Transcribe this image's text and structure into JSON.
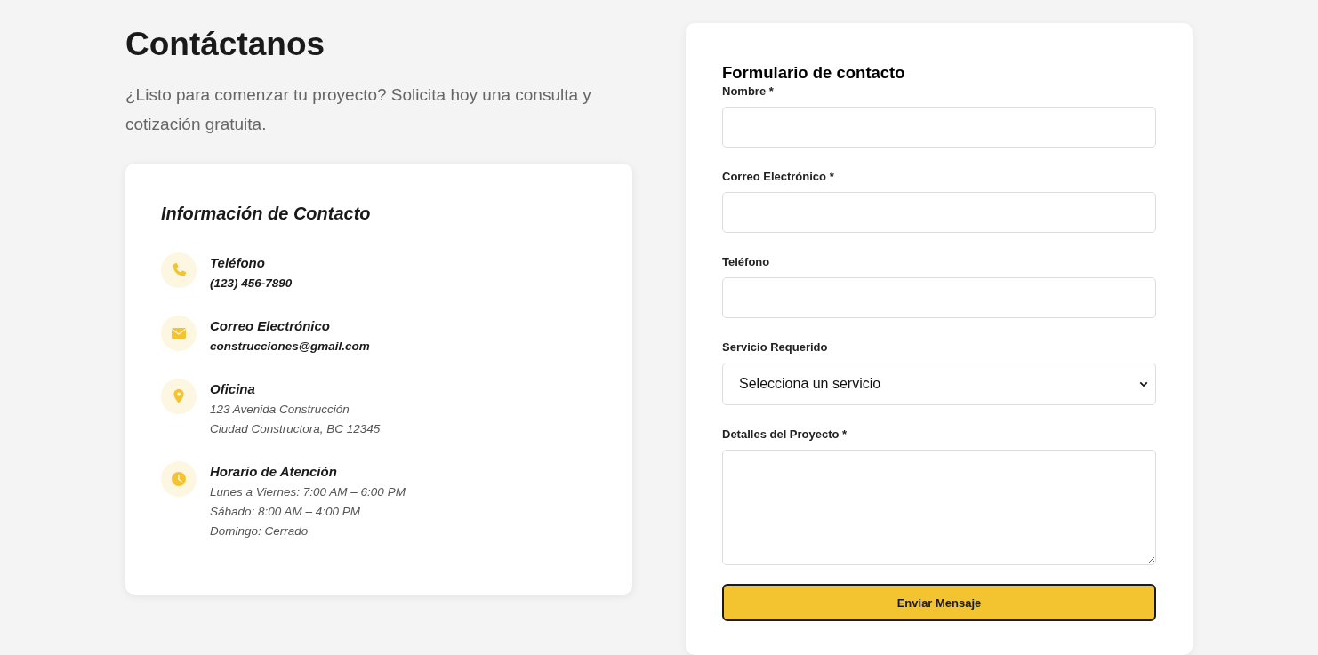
{
  "header": {
    "title": "Contáctanos",
    "subtitle": "¿Listo para comenzar tu proyecto? Solicita hoy una consulta y cotización gratuita."
  },
  "contact_info": {
    "title": "Información de Contacto",
    "items": [
      {
        "kind": "phone",
        "label": "Teléfono",
        "linked": true,
        "lines": [
          "(123) 456-7890"
        ]
      },
      {
        "kind": "email",
        "label": "Correo Electrónico",
        "linked": true,
        "lines": [
          "construcciones@gmail.com"
        ]
      },
      {
        "kind": "location",
        "label": "Oficina",
        "linked": false,
        "lines": [
          "123 Avenida Construcción",
          "Ciudad Constructora, BC 12345"
        ]
      },
      {
        "kind": "clock",
        "label": "Horario de Atención",
        "linked": false,
        "lines": [
          "Lunes a Viernes: 7:00 AM – 6:00 PM",
          "Sábado: 8:00 AM – 4:00 PM",
          "Domingo: Cerrado"
        ]
      }
    ]
  },
  "form": {
    "title": "Formulario de contacto",
    "fields": [
      {
        "kind": "input",
        "label": "Nombre *"
      },
      {
        "kind": "input",
        "label": "Correo Electrónico *"
      },
      {
        "kind": "input",
        "label": "Teléfono"
      },
      {
        "kind": "select",
        "label": "Servicio Requerido",
        "value": "Selecciona un servicio"
      },
      {
        "kind": "textarea",
        "label": "Detalles del Proyecto *"
      }
    ],
    "submit": "Enviar Mensaje"
  }
}
